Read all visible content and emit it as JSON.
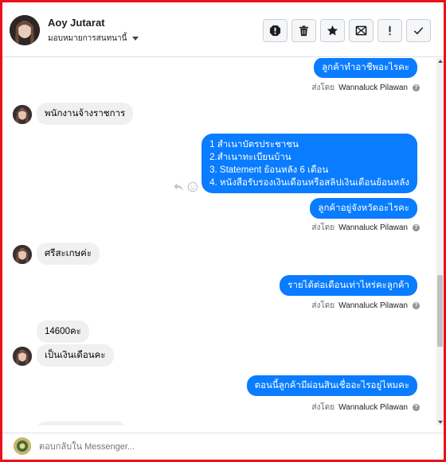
{
  "header": {
    "name": "Aoy Jutarat",
    "assign_label": "มอบหมายการสนทนานี้"
  },
  "toolbar": {
    "icons": [
      "spam-report-icon",
      "trash-icon",
      "star-icon",
      "mark-unread-icon",
      "alert-icon",
      "check-icon"
    ]
  },
  "messages": [
    {
      "id": "m1",
      "direction": "out",
      "text": "ลูกค้าทำอาชีพอะไรคะ"
    },
    {
      "id": "m2",
      "direction": "in",
      "text": "พนักงานจ้างราชการ"
    },
    {
      "id": "m3",
      "direction": "out",
      "lines": [
        "1 สำเนาบัตรประชาชน",
        "2.สำเนาทะเบียนบ้าน",
        " 3. Statement ย้อนหลัง 6 เดือน",
        "4. หนังสือรับรองเงินเดือนหรือสลิปเงินเดือนย้อนหลัง"
      ]
    },
    {
      "id": "m4",
      "direction": "out",
      "text": "ลูกค้าอยู่จังหวัดอะไรคะ"
    },
    {
      "id": "m5",
      "direction": "in",
      "text": "ศรีสะเกษค่ะ"
    },
    {
      "id": "m6",
      "direction": "out",
      "text": "รายได้ต่อเดือนเท่าไหร่คะลูกค้า"
    },
    {
      "id": "m7",
      "direction": "in",
      "text": "14600คะ"
    },
    {
      "id": "m8",
      "direction": "in",
      "text": "เป็นเงินเดือนคะ"
    },
    {
      "id": "m9",
      "direction": "out",
      "text": "ตอนนี้ลูกค้ามีผ่อนสินเชื่ออะไรอยู่ไหมคะ"
    }
  ],
  "sent_by": {
    "prefix": "ส่งโดย",
    "sender": "Wannaluck Pilawan"
  },
  "composer": {
    "placeholder": "ตอบกลับใน Messenger..."
  },
  "colors": {
    "frame": "#e8101a",
    "outgoing_bubble": "#0a7cff",
    "incoming_bubble": "#f0f0f0"
  }
}
